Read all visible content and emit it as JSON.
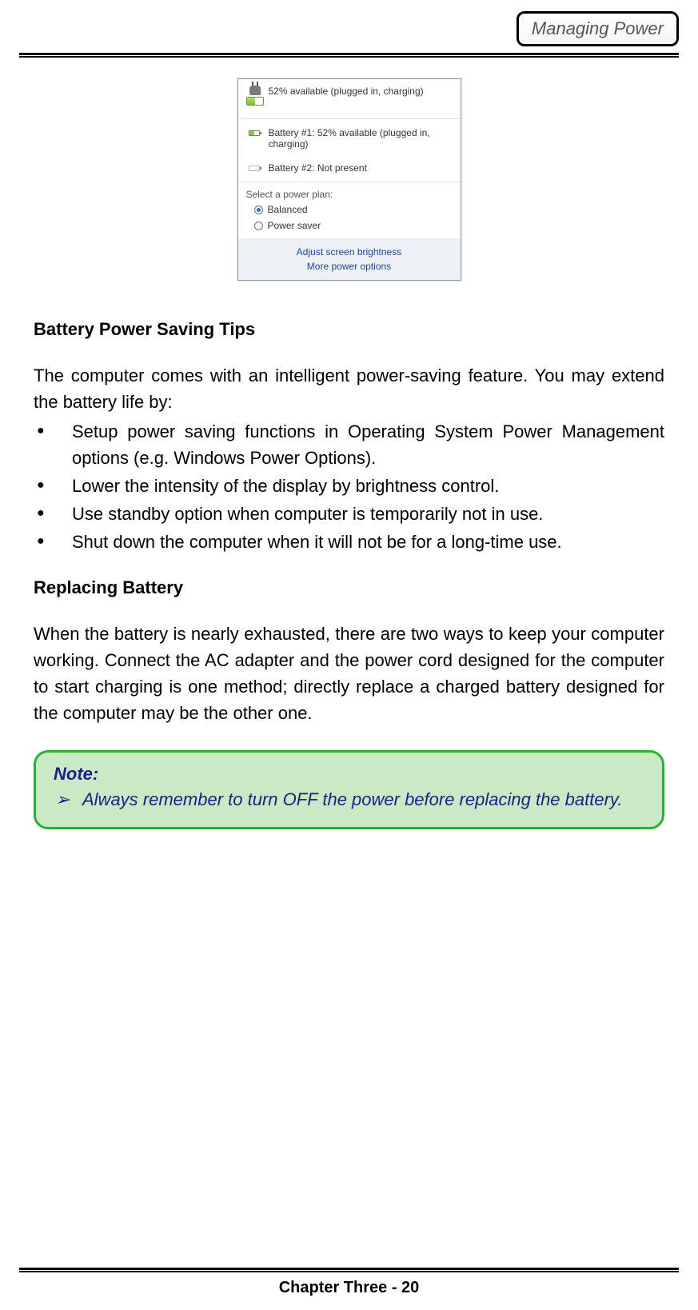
{
  "header": {
    "title": "Managing Power"
  },
  "popup": {
    "summary": "52% available (plugged in, charging)",
    "battery1": "Battery #1: 52% available (plugged in, charging)",
    "battery2": "Battery #2: Not present",
    "plan_label": "Select a power plan:",
    "plan_balanced": "Balanced",
    "plan_saver": "Power saver",
    "link_brightness": "Adjust screen brightness",
    "link_more": "More power options"
  },
  "sections": {
    "tips_title": "Battery Power Saving Tips",
    "tips_intro": "The computer comes with an intelligent power-saving feature. You may extend the battery life by:",
    "tips": [
      "Setup power saving functions in Operating System Power Management options (e.g. Windows Power Options).",
      "Lower the intensity of the display by brightness control.",
      "Use standby option when computer is temporarily not in use.",
      "Shut down the computer when it will not be for a long-time use."
    ],
    "replace_title": "Replacing Battery",
    "replace_body": "When the battery is nearly exhausted, there are two ways to keep your computer working. Connect the AC adapter and the power cord designed for the computer to start charging is one method; directly replace a charged battery designed for the computer may be the other one."
  },
  "note": {
    "title": "Note:",
    "items": [
      "Always remember to turn OFF the power before replacing the battery."
    ]
  },
  "footer": {
    "page": "Chapter Three - 20"
  }
}
